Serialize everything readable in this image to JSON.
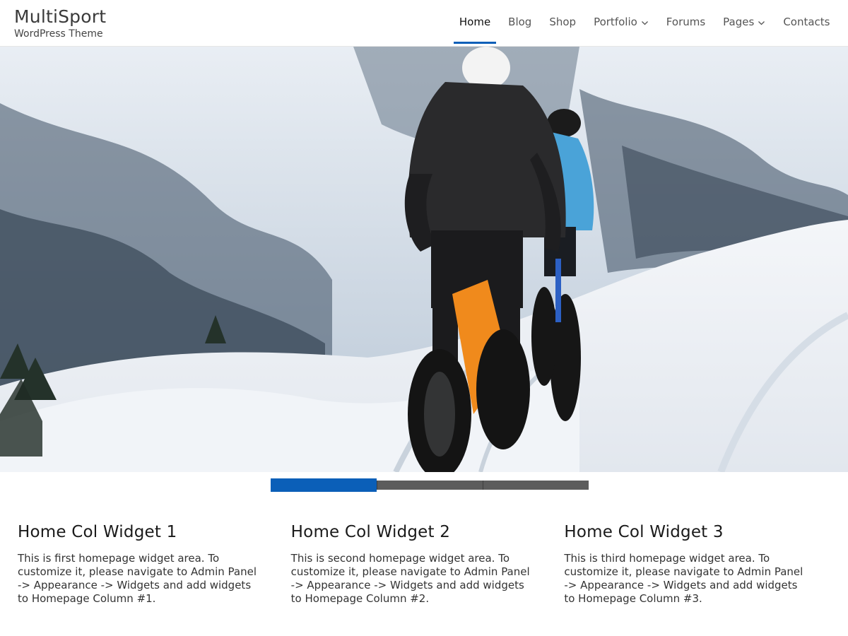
{
  "site": {
    "title": "MultiSport",
    "tagline": "WordPress Theme"
  },
  "nav": {
    "items": [
      {
        "label": "Home",
        "active": true,
        "has_dropdown": false
      },
      {
        "label": "Blog",
        "active": false,
        "has_dropdown": false
      },
      {
        "label": "Shop",
        "active": false,
        "has_dropdown": false
      },
      {
        "label": "Portfolio",
        "active": false,
        "has_dropdown": true
      },
      {
        "label": "Forums",
        "active": false,
        "has_dropdown": false
      },
      {
        "label": "Pages",
        "active": false,
        "has_dropdown": true
      },
      {
        "label": "Contacts",
        "active": false,
        "has_dropdown": false
      }
    ]
  },
  "slider": {
    "slide_count": 3,
    "active_slide": 1
  },
  "widgets": [
    {
      "title": "Home Col Widget 1",
      "text": "This is first homepage widget area. To customize it, please navigate to Admin Panel -> Appearance -> Widgets and add widgets to Homepage Column #1."
    },
    {
      "title": "Home Col Widget 2",
      "text": "This is second homepage widget area. To customize it, please navigate to Admin Panel -> Appearance -> Widgets and add widgets to Homepage Column #2."
    },
    {
      "title": "Home Col Widget 3",
      "text": "This is third homepage widget area. To customize it, please navigate to Admin Panel -> Appearance -> Widgets and add widgets to Homepage Column #3."
    }
  ],
  "colors": {
    "accent": "#0b5fb8",
    "pager_inactive": "#5c5c5c"
  },
  "icons": {
    "dropdown": "chevron-down-icon"
  }
}
